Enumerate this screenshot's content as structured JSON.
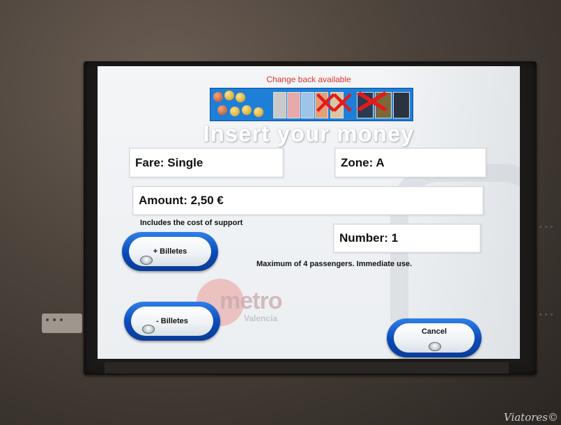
{
  "screen": {
    "change_label": "Change back available",
    "title": "Insert your money",
    "fare": "Fare: Single",
    "zone": "Zone: A",
    "amount": "Amount: 2,50 €",
    "support_note": "Includes the cost of support",
    "number": "Number: 1",
    "passengers_note": "Maximum of 4 passengers. Immediate use.",
    "buttons": {
      "add": "+ Billetes",
      "remove": "- Billetes",
      "cancel": "Cancel"
    },
    "logo": {
      "word": "metro",
      "sub": "Valencia"
    }
  },
  "photo_watermark": "Viatores©",
  "colors": {
    "alert_text": "#e0342f",
    "button_blue": "#0b49b8",
    "coin_strip": "#1e7fd8"
  },
  "icons": [
    "coin-icon",
    "banknote-icon",
    "unavailable-x-icon",
    "button-knob-icon"
  ]
}
